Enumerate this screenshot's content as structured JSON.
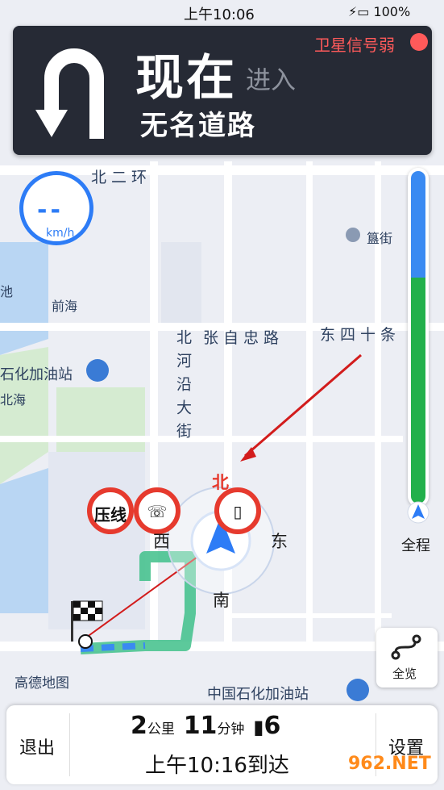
{
  "status_bar": {
    "time": "上午10:06",
    "battery": "100%"
  },
  "nav_card": {
    "instruction": "现在",
    "action": "进入",
    "road": "无名道路",
    "signal_warning": "卫星信号弱"
  },
  "speed": {
    "value": "--",
    "unit": "km/h"
  },
  "map_labels": {
    "beierhuan": "北二环",
    "zhangzizhong": "张自忠路",
    "dongsi": "东四十条",
    "beiheyan": "北河沿大街",
    "qianhai": "前海",
    "beihai": "北海",
    "guijie": "簋街",
    "gas_station_top": "石化加油站",
    "gas_station_bottom": "中国石化加油站",
    "gas_station_left": "石化加油站",
    "chi": "池"
  },
  "compass": {
    "north": "北",
    "south": "南",
    "west": "西",
    "east": "东"
  },
  "signs": {
    "lane_line": "压线"
  },
  "route_progress": {
    "remaining_fraction": 0.68
  },
  "buttons": {
    "overview": "全程",
    "full_view": "全览",
    "exit": "退出",
    "settings": "设置"
  },
  "trip": {
    "distance_value": "2",
    "distance_unit": "公里",
    "time_value": "11",
    "time_unit": "分钟",
    "lights": "6",
    "eta": "上午10:16到达"
  },
  "logo": {
    "text": "高德地图"
  },
  "watermark": {
    "text": "962.NET"
  },
  "colors": {
    "route": "#3fbf8a",
    "accent": "#2d7cf6",
    "warning": "#ff5a5a",
    "card_bg": "#262a35"
  }
}
